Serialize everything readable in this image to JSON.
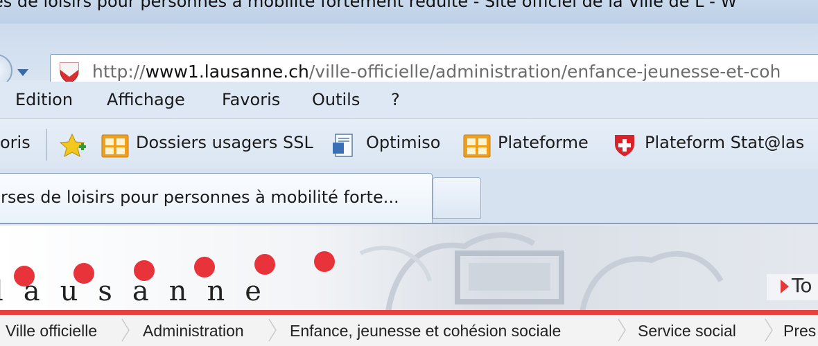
{
  "window": {
    "title": "es de loisirs pour personnes à mobilité fortement réduite - Site officiel de la Ville de L - W"
  },
  "address_bar": {
    "url_prefix": "http://",
    "url_domain": "www1.lausanne.ch",
    "url_path": "/ville-officielle/administration/enfance-jeunesse-et-coh"
  },
  "menu": {
    "items": [
      "Edition",
      "Affichage",
      "Favoris",
      "Outils",
      "?"
    ]
  },
  "favorites": {
    "partial_label": "oris",
    "items": [
      {
        "label": "Dossiers usagers SSL",
        "icon": "folder-grid-icon"
      },
      {
        "label": "Optimiso",
        "icon": "document-icon"
      },
      {
        "label": "Plateforme",
        "icon": "folder-grid-icon"
      },
      {
        "label": "Plateform Stat@las",
        "icon": "swiss-shield-icon"
      }
    ]
  },
  "tabs": {
    "active_label": "rses de loisirs pour personnes à mobilité forte..."
  },
  "site": {
    "logo_text": "lausanne",
    "right_link": "To",
    "brand_color": "#e8333a"
  },
  "breadcrumb": [
    "Ville officielle",
    "Administration",
    "Enfance, jeunesse et cohésion sociale",
    "Service social",
    "Pres"
  ]
}
